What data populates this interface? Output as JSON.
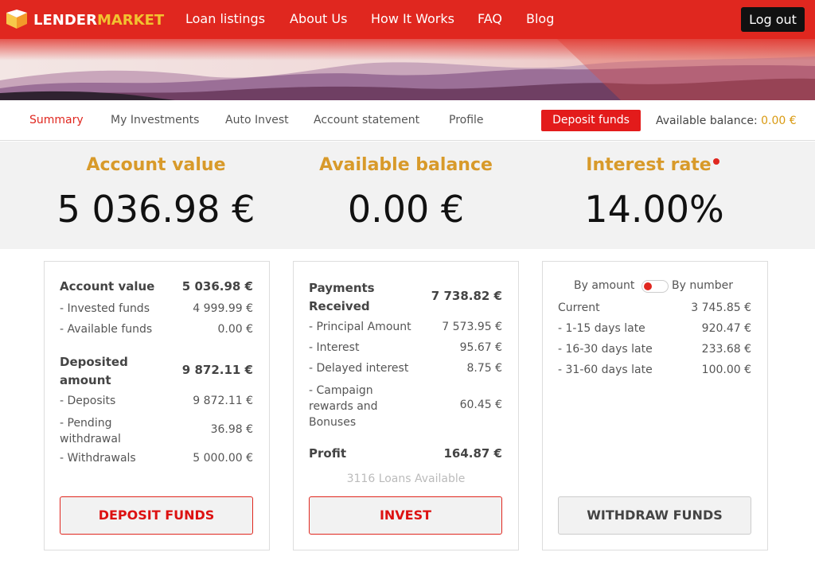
{
  "brand": {
    "part1": "LENDER",
    "part2": "MARKET",
    "accent": "#e0271f",
    "gold": "#f2c230"
  },
  "nav": {
    "links": [
      "Loan listings",
      "About Us",
      "How It Works",
      "FAQ",
      "Blog"
    ],
    "logout": "Log out"
  },
  "subnav": {
    "tabs": [
      "Summary",
      "My Investments",
      "Auto Invest",
      "Account statement",
      "Profile"
    ],
    "active": "Summary",
    "deposit_button": "Deposit funds",
    "available_label": "Available balance: ",
    "available_value": "0.00 €"
  },
  "stats": [
    {
      "title": "Account value",
      "value": "5 036.98 €"
    },
    {
      "title": "Available balance",
      "value": "0.00 €"
    },
    {
      "title": "Interest rate",
      "value": "14.00%"
    }
  ],
  "card1": {
    "rows": [
      {
        "label": "Account value",
        "value": "5 036.98 €",
        "bold": true
      },
      {
        "label": "- Invested funds",
        "value": "4 999.99 €"
      },
      {
        "label": "- Available funds",
        "value": "0.00 €"
      },
      {
        "label": "Deposited amount",
        "value": "9 872.11 €",
        "bold": true
      },
      {
        "label": "- Deposits",
        "value": "9 872.11 €"
      },
      {
        "label": "- Pending withdrawal",
        "value": "36.98 €"
      },
      {
        "label": "- Withdrawals",
        "value": "5 000.00 €"
      }
    ],
    "button": "DEPOSIT FUNDS"
  },
  "card2": {
    "rows": [
      {
        "label": "Payments Received",
        "value": "7 738.82 €",
        "bold": true
      },
      {
        "label": "- Principal Amount",
        "value": "7 573.95 €"
      },
      {
        "label": "- Interest",
        "value": "95.67 €"
      },
      {
        "label": "- Delayed interest",
        "value": "8.75 €"
      },
      {
        "label": "- Campaign rewards and Bonuses",
        "value": "60.45 €"
      },
      {
        "label": "Profit",
        "value": "164.87 €",
        "bold": true
      }
    ],
    "loans_available": "3116 Loans Available",
    "button": "INVEST"
  },
  "card3": {
    "toggle_left": "By amount",
    "toggle_right": "By number",
    "rows": [
      {
        "label": "Current",
        "value": "3 745.85 €"
      },
      {
        "label": "- 1-15 days late",
        "value": "920.47 €"
      },
      {
        "label": "- 16-30 days late",
        "value": "233.68 €"
      },
      {
        "label": "- 31-60 days late",
        "value": "100.00 €"
      }
    ],
    "button": "WITHDRAW FUNDS"
  }
}
